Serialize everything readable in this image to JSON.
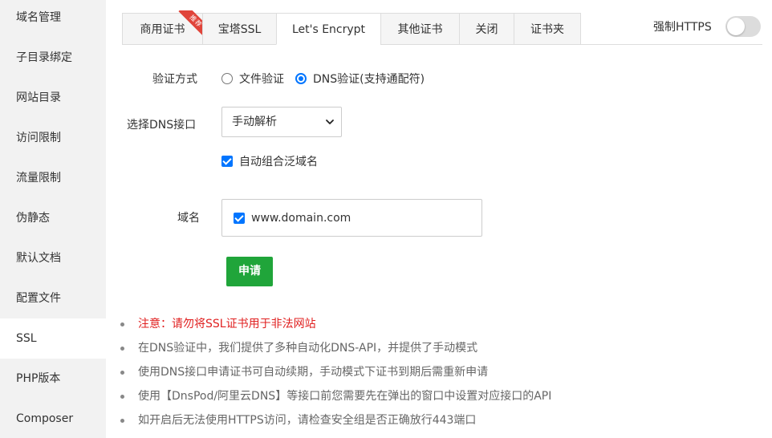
{
  "sidebar": {
    "items": [
      {
        "label": "域名管理"
      },
      {
        "label": "子目录绑定"
      },
      {
        "label": "网站目录"
      },
      {
        "label": "访问限制"
      },
      {
        "label": "流量限制"
      },
      {
        "label": "伪静态"
      },
      {
        "label": "默认文档"
      },
      {
        "label": "配置文件"
      },
      {
        "label": "SSL"
      },
      {
        "label": "PHP版本"
      },
      {
        "label": "Composer"
      }
    ],
    "active_index": 8
  },
  "tabs": {
    "items": [
      {
        "label": "商用证书",
        "badge": "推荐"
      },
      {
        "label": "宝塔SSL"
      },
      {
        "label": "Let's Encrypt"
      },
      {
        "label": "其他证书"
      },
      {
        "label": "关闭"
      },
      {
        "label": "证书夹"
      }
    ],
    "active_index": 2
  },
  "force_https": {
    "label": "强制HTTPS",
    "enabled": false
  },
  "form": {
    "verify_label": "验证方式",
    "verify_options": [
      {
        "label": "文件验证",
        "checked": false
      },
      {
        "label": "DNS验证(支持通配符)",
        "checked": true
      }
    ],
    "dns_label": "选择DNS接口",
    "dns_selected": "手动解析",
    "auto_wildcard_label": "自动组合泛域名",
    "auto_wildcard_checked": true,
    "domain_label": "域名",
    "domains": [
      {
        "name": "www.domain.com",
        "checked": true
      }
    ],
    "apply_label": "申请"
  },
  "notes": [
    {
      "text": "注意：请勿将SSL证书用于非法网站",
      "warn": true
    },
    {
      "text": "在DNS验证中，我们提供了多种自动化DNS-API，并提供了手动模式",
      "warn": false
    },
    {
      "text": "使用DNS接口申请证书可自动续期，手动模式下证书到期后需重新申请",
      "warn": false
    },
    {
      "text": "使用【DnsPod/阿里云DNS】等接口前您需要先在弹出的窗口中设置对应接口的API",
      "warn": false
    },
    {
      "text": "如开启后无法使用HTTPS访问，请检查安全组是否正确放行443端口",
      "warn": false
    }
  ],
  "colors": {
    "accent_green": "#20a53a",
    "radio_blue": "#0075ff",
    "warning_red": "#e02020",
    "badge_red": "#e0443a"
  }
}
